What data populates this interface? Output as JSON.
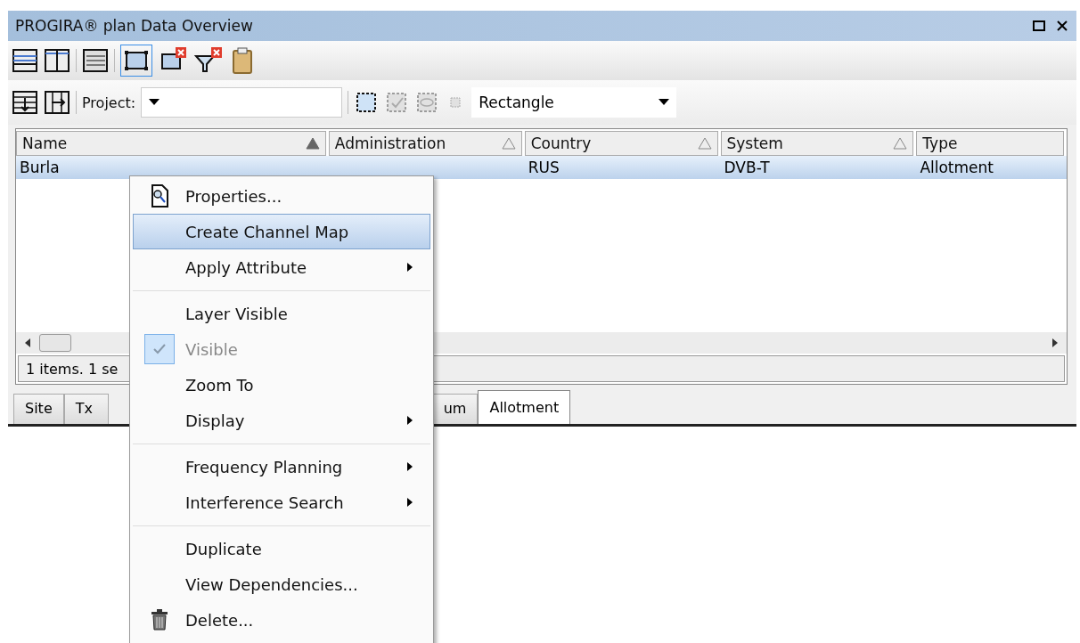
{
  "window": {
    "title": "PROGIRA® plan Data Overview"
  },
  "toolbar2": {
    "project_label": "Project:",
    "shape_select": "Rectangle"
  },
  "table": {
    "columns": [
      {
        "label": "Name",
        "sorted": true,
        "sortable": true
      },
      {
        "label": "Administration",
        "sorted": false,
        "sortable": true
      },
      {
        "label": "Country",
        "sorted": false,
        "sortable": true
      },
      {
        "label": "System",
        "sorted": false,
        "sortable": true
      },
      {
        "label": "Type",
        "sortable": false
      }
    ],
    "rows": [
      {
        "selected": true,
        "cells": [
          "Burla",
          "",
          "RUS",
          "DVB-T",
          "Allotment"
        ]
      }
    ]
  },
  "status_bar": "1 items. 1 se",
  "tabs": [
    {
      "label": "Site",
      "selected": false
    },
    {
      "label": "Tx",
      "selected": false
    },
    {
      "label": "um",
      "selected": false
    },
    {
      "label": "Allotment",
      "selected": true
    }
  ],
  "context_menu": [
    {
      "kind": "properties",
      "label": "Properties...",
      "selected": false
    },
    {
      "kind": "item",
      "label": "Create Channel Map",
      "selected": true
    },
    {
      "kind": "item",
      "label": "Apply Attribute",
      "submenu": true,
      "selected": false
    },
    {
      "kind": "separator"
    },
    {
      "kind": "item",
      "label": "Layer Visible",
      "selected": false
    },
    {
      "kind": "item",
      "label": "Visible",
      "checked": true,
      "disabled": true,
      "selected": false
    },
    {
      "kind": "item",
      "label": "Zoom To",
      "selected": false
    },
    {
      "kind": "item",
      "label": "Display",
      "submenu": true,
      "selected": false
    },
    {
      "kind": "separator"
    },
    {
      "kind": "item",
      "label": "Frequency Planning",
      "submenu": true,
      "selected": false
    },
    {
      "kind": "item",
      "label": "Interference Search",
      "submenu": true,
      "selected": false
    },
    {
      "kind": "separator"
    },
    {
      "kind": "item",
      "label": "Duplicate",
      "selected": false
    },
    {
      "kind": "item",
      "label": "View Dependencies...",
      "selected": false
    },
    {
      "kind": "delete",
      "label": "Delete...",
      "selected": false
    }
  ]
}
